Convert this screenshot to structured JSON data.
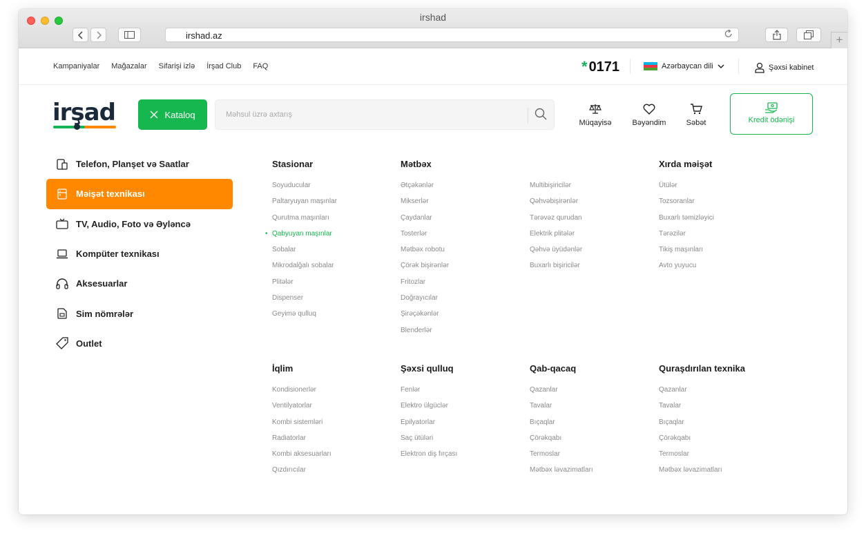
{
  "browser": {
    "title": "irshad",
    "url": "irshad.az"
  },
  "topnav": {
    "links": [
      "Kampaniyalar",
      "Mağazalar",
      "Sifarişi izlə",
      "İrşad Club",
      "FAQ"
    ],
    "phone": "0171",
    "phone_star": "*",
    "language": "Azərbaycan dili",
    "cabinet": "Şəxsi kabinet"
  },
  "header": {
    "logo": "irşad",
    "catalog_label": "Kataloq",
    "search_placeholder": "Məhsul üzrə axtarış",
    "compare": "Müqayisə",
    "favorites": "Bəyəndim",
    "cart": "Səbət",
    "credit": "Kredit ödənişi"
  },
  "sidebar": {
    "items": [
      {
        "label": "Telefon, Planşet və Saatlar",
        "icon": "phone-tablet-icon"
      },
      {
        "label": "Məişət texnikası",
        "icon": "fridge-icon"
      },
      {
        "label": "TV, Audio, Foto və Əyləncə",
        "icon": "tv-icon"
      },
      {
        "label": "Kompüter texnikası",
        "icon": "laptop-icon"
      },
      {
        "label": "Aksesuarlar",
        "icon": "headphones-icon"
      },
      {
        "label": "Sim nömrələr",
        "icon": "sim-card-icon"
      },
      {
        "label": "Outlet",
        "icon": "tag-icon"
      }
    ],
    "active_index": 1
  },
  "menu": {
    "stasionar": {
      "title": "Stasionar",
      "items": [
        "Soyuducular",
        "Paltaryuyan maşınlar",
        "Qurutma maşınları",
        "Qabyuyan maşınlar",
        "Sobalar",
        "Mikrodalğalı sobalar",
        "Plitələr",
        "Dispenser",
        "Geyimə qulluq"
      ],
      "selected_index": 3
    },
    "metbex": {
      "title": "Mətbəx",
      "items": [
        "Ətçəkənlər",
        "Mikserlər",
        "Çaydanlar",
        "Tosterlər",
        "Mətbəx robotu",
        "Çörək bişirənlər",
        "Fritozlar",
        "Doğrayıcılar",
        "Şirəçəkənlər",
        "Blenderlər"
      ]
    },
    "metbex2": {
      "items": [
        "Multibişiricilər",
        "Qəhvəbişirənlər",
        "Tərəvəz qurudan",
        "Elektrik plitələr",
        "Qəhvə üyüdənlər",
        "Buxarlı bişiricilər"
      ]
    },
    "xirda": {
      "title": "Xırda məişət",
      "items": [
        "Ütülər",
        "Tozsoranlar",
        "Buxarlı təmizləyici",
        "Tərəzilər",
        "Tikiş maşınları",
        "Avto yuyucu"
      ]
    },
    "iqlim": {
      "title": "İqlim",
      "items": [
        "Kondisionerlər",
        "Ventilyatorlar",
        "Kombi sistemləri",
        "Radiatorlar",
        "Kombi aksesuarları",
        "Qızdırıcılar"
      ]
    },
    "sexsi": {
      "title": "Şəxsi qulluq",
      "items": [
        "Fenlər",
        "Elektro ülgüclər",
        "Epilyatorlar",
        "Saç ütüləri",
        "Elektron diş fırçası"
      ]
    },
    "qab": {
      "title": "Qab-qacaq",
      "items": [
        "Qazanlar",
        "Tavalar",
        "Bıçaqlar",
        "Çörəkqabı",
        "Termoslar",
        "Mətbəx ləvazimatları"
      ]
    },
    "qurasdirilan": {
      "title": "Quraşdırılan texnika",
      "items": [
        "Qazanlar",
        "Tavalar",
        "Bıçaqlar",
        "Çörəkqabı",
        "Termoslar",
        "Mətbəx ləvazimatları"
      ]
    }
  },
  "colors": {
    "brand_green": "#16b74e",
    "brand_orange": "#ff8800",
    "logo_navy": "#1b2a3b"
  }
}
